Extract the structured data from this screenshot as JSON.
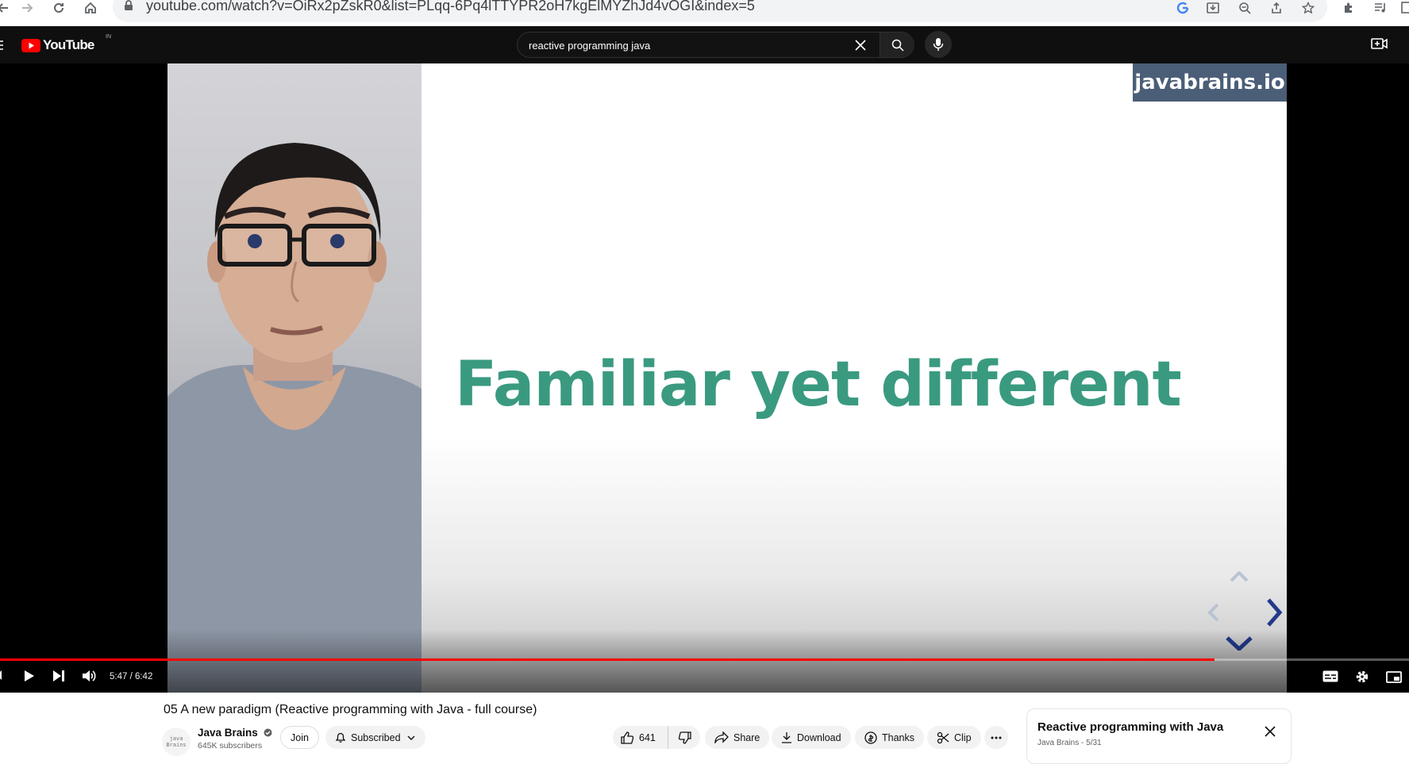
{
  "browser": {
    "url": "youtube.com/watch?v=OiRx2pZskR0&list=PLqq-6Pq4lTTYPR2oH7kgElMYZhJd4vOGI&index=5"
  },
  "header": {
    "logo_text": "YouTube",
    "country_code": "IN",
    "search_query": "reactive programming java"
  },
  "video": {
    "slide_title": "Familiar yet different",
    "brand_badge": "javabrains.io",
    "current_time": "5:47",
    "duration": "6:42",
    "time_display": "5:47 / 6:42",
    "progress_fraction": 0.862,
    "progress_color": "#ff0000"
  },
  "info": {
    "title": "05 A new paradigm (Reactive programming with Java - full course)",
    "channel_name": "Java Brains",
    "avatar_text": "java\nBrains",
    "subscribers": "645K subscribers",
    "join_label": "Join",
    "subscribed_label": "Subscribed",
    "like_count": "641",
    "share_label": "Share",
    "download_label": "Download",
    "thanks_label": "Thanks",
    "clip_label": "Clip"
  },
  "playlist": {
    "title": "Reactive programming with Java",
    "meta": "Java Brains - 5/31"
  },
  "colors": {
    "yt_red": "#ff0000",
    "slide_green": "#3a9a80",
    "brand_blue": "#4b5e78",
    "header_bg": "#0f0f0f"
  }
}
